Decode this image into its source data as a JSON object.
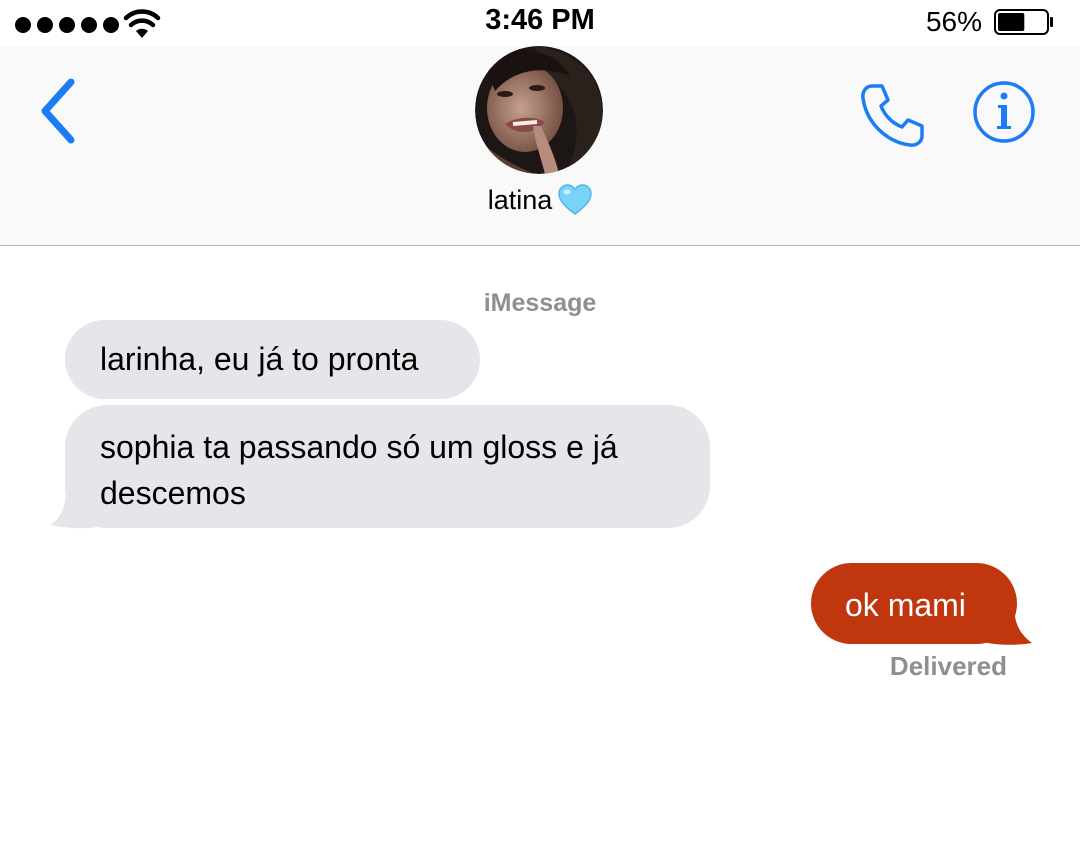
{
  "status_bar": {
    "time": "3:46 PM",
    "battery_percent": "56%",
    "battery_level": 0.56,
    "signal_bars": 5
  },
  "header": {
    "contact_name": "latina",
    "contact_emoji": "light-blue-heart",
    "back_icon": "chevron-left-icon",
    "call_icon": "phone-icon",
    "info_icon": "info-icon"
  },
  "conversation": {
    "service_label": "iMessage",
    "messages": [
      {
        "direction": "incoming",
        "text": "larinha, eu já to pronta"
      },
      {
        "direction": "incoming",
        "lines": [
          "sophia ta passando só um gloss e já",
          "descemos"
        ]
      },
      {
        "direction": "outgoing",
        "text": "ok mami"
      }
    ],
    "delivery_status": "Delivered"
  },
  "colors": {
    "accent": "#1b7cf5",
    "incoming_bubble": "#e5e5ea",
    "outgoing_bubble": "#c0360f",
    "meta_text": "#8e8e93"
  }
}
